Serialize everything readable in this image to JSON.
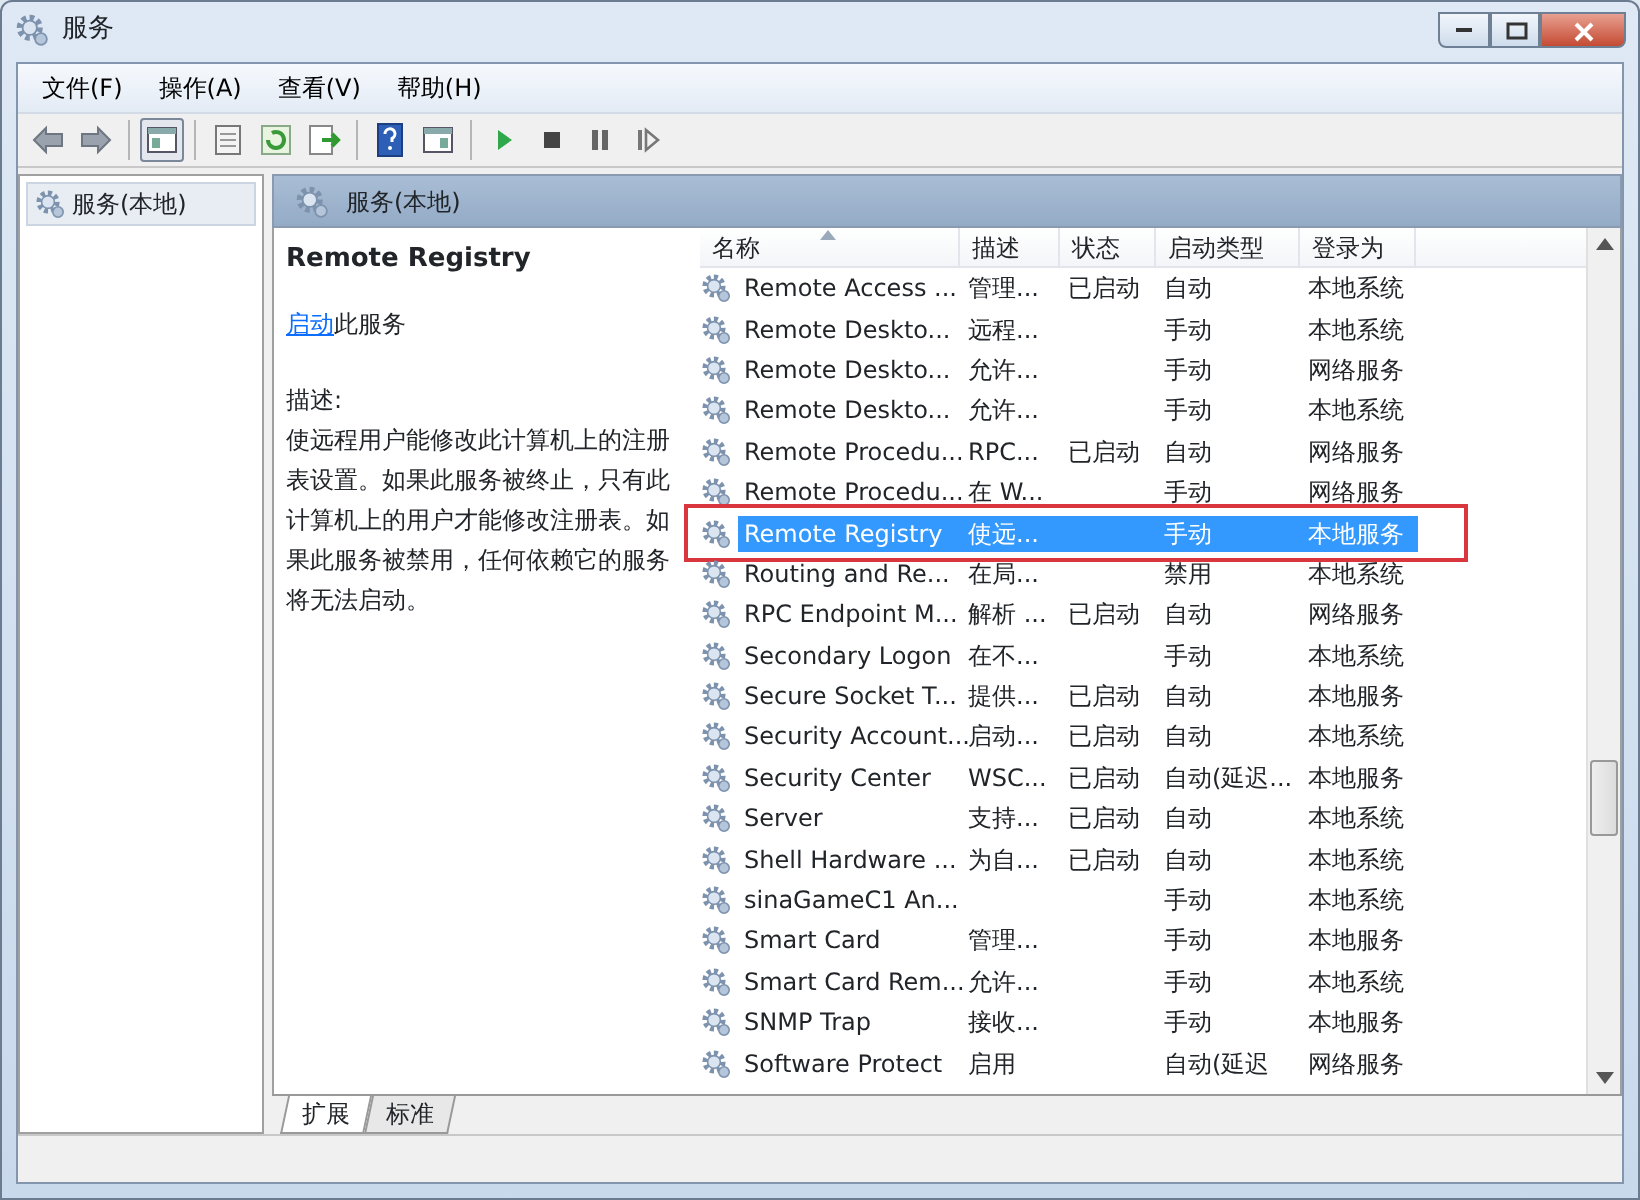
{
  "window": {
    "title": "服务"
  },
  "menu": [
    "文件(F)",
    "操作(A)",
    "查看(V)",
    "帮助(H)"
  ],
  "toolbar": [
    {
      "kind": "back",
      "disabled": false
    },
    {
      "kind": "forward",
      "disabled": false
    },
    {
      "kind": "sep"
    },
    {
      "kind": "tree",
      "pressed": true
    },
    {
      "kind": "sep"
    },
    {
      "kind": "props"
    },
    {
      "kind": "refresh"
    },
    {
      "kind": "export"
    },
    {
      "kind": "sep"
    },
    {
      "kind": "help"
    },
    {
      "kind": "pane"
    },
    {
      "kind": "sep"
    },
    {
      "kind": "play"
    },
    {
      "kind": "stop"
    },
    {
      "kind": "pause"
    },
    {
      "kind": "resume"
    }
  ],
  "tree": [
    {
      "label": "服务(本地)",
      "selected": true
    }
  ],
  "pane_title": "服务(本地)",
  "detail": {
    "title": "Remote Registry",
    "link": "启动",
    "link_suffix": "此服务",
    "desc_label": "描述:",
    "description": "使远程用户能修改此计算机上的注册表设置。如果此服务被终止，只有此计算机上的用户才能修改注册表。如果此服务被禁用，任何依赖它的服务将无法启动。"
  },
  "columns": [
    "名称",
    "描述",
    "状态",
    "启动类型",
    "登录为"
  ],
  "rows": [
    {
      "cells": [
        "Remote Access ...",
        "管理...",
        "已启动",
        "自动",
        "本地系统"
      ],
      "selected": false,
      "outlined": false
    },
    {
      "cells": [
        "Remote Deskto...",
        "远程...",
        "",
        "手动",
        "本地系统"
      ],
      "selected": false,
      "outlined": false
    },
    {
      "cells": [
        "Remote Deskto...",
        "允许...",
        "",
        "手动",
        "网络服务"
      ],
      "selected": false,
      "outlined": false
    },
    {
      "cells": [
        "Remote Deskto...",
        "允许...",
        "",
        "手动",
        "本地系统"
      ],
      "selected": false,
      "outlined": false
    },
    {
      "cells": [
        "Remote Procedu...",
        "RPC...",
        "已启动",
        "自动",
        "网络服务"
      ],
      "selected": false,
      "outlined": false
    },
    {
      "cells": [
        "Remote Procedu...",
        "在 W...",
        "",
        "手动",
        "网络服务"
      ],
      "selected": false,
      "outlined": false
    },
    {
      "cells": [
        "Remote Registry",
        "使远...",
        "",
        "手动",
        "本地服务"
      ],
      "selected": true,
      "outlined": true
    },
    {
      "cells": [
        "Routing and Re...",
        "在局...",
        "",
        "禁用",
        "本地系统"
      ],
      "selected": false,
      "outlined": false
    },
    {
      "cells": [
        "RPC Endpoint M...",
        "解析 ...",
        "已启动",
        "自动",
        "网络服务"
      ],
      "selected": false,
      "outlined": false
    },
    {
      "cells": [
        "Secondary Logon",
        "在不...",
        "",
        "手动",
        "本地系统"
      ],
      "selected": false,
      "outlined": false
    },
    {
      "cells": [
        "Secure Socket T...",
        "提供...",
        "已启动",
        "自动",
        "本地服务"
      ],
      "selected": false,
      "outlined": false
    },
    {
      "cells": [
        "Security Account...",
        "启动...",
        "已启动",
        "自动",
        "本地系统"
      ],
      "selected": false,
      "outlined": false
    },
    {
      "cells": [
        "Security Center",
        "WSC...",
        "已启动",
        "自动(延迟...",
        "本地服务"
      ],
      "selected": false,
      "outlined": false
    },
    {
      "cells": [
        "Server",
        "支持...",
        "已启动",
        "自动",
        "本地系统"
      ],
      "selected": false,
      "outlined": false
    },
    {
      "cells": [
        "Shell Hardware ...",
        "为自...",
        "已启动",
        "自动",
        "本地系统"
      ],
      "selected": false,
      "outlined": false
    },
    {
      "cells": [
        "sinaGameC1 An...",
        "",
        "",
        "手动",
        "本地系统"
      ],
      "selected": false,
      "outlined": false
    },
    {
      "cells": [
        "Smart Card",
        "管理...",
        "",
        "手动",
        "本地服务"
      ],
      "selected": false,
      "outlined": false
    },
    {
      "cells": [
        "Smart Card Rem...",
        "允许...",
        "",
        "手动",
        "本地系统"
      ],
      "selected": false,
      "outlined": false
    },
    {
      "cells": [
        "SNMP Trap",
        "接收...",
        "",
        "手动",
        "本地服务"
      ],
      "selected": false,
      "outlined": false
    },
    {
      "cells": [
        "Software Protect",
        "启用",
        "",
        "自动(延迟",
        "网络服务"
      ],
      "selected": false,
      "outlined": false
    }
  ],
  "tabs": [
    {
      "label": "扩展",
      "selected": true
    },
    {
      "label": "标准",
      "selected": false
    }
  ]
}
